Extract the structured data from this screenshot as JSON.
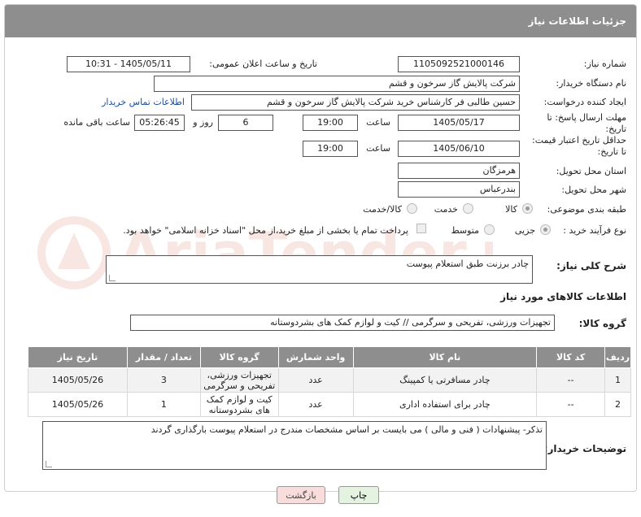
{
  "header": {
    "title": "جزئیات اطلاعات نیاز"
  },
  "form": {
    "need_number_label": "شماره نیاز:",
    "need_number": "1105092521000146",
    "announce_label": "تاریخ و ساعت اعلان عمومی:",
    "announce_value": "1405/05/11 - 10:31",
    "buyer_org_label": "نام دستگاه خریدار:",
    "buyer_org": "شرکت پالایش گاز سرخون و قشم",
    "requester_label": "ایجاد کننده درخواست:",
    "requester": "حسین طالبی فر کارشناس خرید شرکت پالایش گاز سرخون و قشم",
    "buyer_contact_link": "اطلاعات تماس خریدار",
    "deadline_label_1": "مهلت ارسال پاسخ: تا",
    "deadline_label_2": "تاریخ:",
    "deadline_date": "1405/05/17",
    "time_label": "ساعت",
    "deadline_time": "19:00",
    "days_value": "6",
    "days_label": "روز و",
    "remaining_time": "05:26:45",
    "remaining_label": "ساعت باقی مانده",
    "validity_label_1": "حداقل تاریخ اعتبار قیمت:",
    "validity_label_2": "تا تاریخ:",
    "validity_date": "1405/06/10",
    "validity_time": "19:00",
    "province_label": "استان محل تحویل:",
    "province": "هرمزگان",
    "city_label": "شهر محل تحویل:",
    "city": "بندرعباس",
    "category_label": "طبقه بندی موضوعی:",
    "category_options": [
      "کالا",
      "خدمت",
      "کالا/خدمت"
    ],
    "process_label": "نوع فرآیند خرید :",
    "process_options": [
      "جزیی",
      "متوسط"
    ],
    "payment_note": "پرداخت تمام یا بخشی از مبلغ خرید،از محل \"اسناد خزانه اسلامی\" خواهد بود."
  },
  "description": {
    "label": "شرح کلی نیاز:",
    "value": "چادر برزنت طبق استعلام پیوست"
  },
  "goods": {
    "section_title": "اطلاعات کالاهای مورد نیاز",
    "group_label": "گروه کالا:",
    "group_value": "تجهیزات ورزشی، تفریحی و سرگرمی // کیت و لوازم کمک های بشردوستانه",
    "columns": [
      "ردیف",
      "کد کالا",
      "نام کالا",
      "واحد شمارش",
      "گروه کالا",
      "تعداد / مقدار",
      "تاریخ نیاز"
    ],
    "rows": [
      {
        "row": "1",
        "code": "--",
        "name": "چادر مسافرتی یا کمپینگ",
        "unit": "عدد",
        "group": "تجهیزات ورزشی، تفریحی و سرگرمی",
        "qty": "3",
        "date": "1405/05/26"
      },
      {
        "row": "2",
        "code": "--",
        "name": "چادر برای استفاده اداری",
        "unit": "عدد",
        "group": "کیت و لوازم کمک های بشردوستانه",
        "qty": "1",
        "date": "1405/05/26"
      }
    ]
  },
  "buyer_notes": {
    "label": "توضیحات خریدار:",
    "value": "تذکر- پیشنهادات ( فنی و مالی ) می بایست بر اساس مشخصات مندرج در استعلام پیوست بارگذاری گردند"
  },
  "buttons": {
    "print": "چاپ",
    "back": "بازگشت"
  },
  "colors": {
    "header_bg": "#8e8e8e",
    "link": "#1a4fa0",
    "back_btn_bg": "#f9dcdc",
    "print_btn_bg": "#e4f3df"
  }
}
